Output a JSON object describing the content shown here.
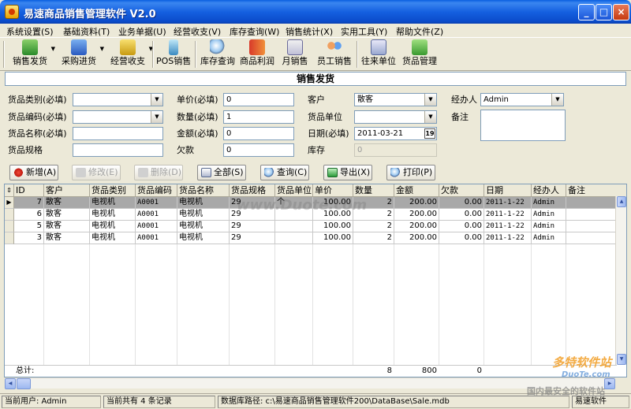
{
  "window": {
    "title": "易速商品销售管理软件 V2.0",
    "min_label": "_",
    "max_label": "□",
    "close_label": "×"
  },
  "menu": [
    "系统设置(S)",
    "基础资料(T)",
    "业务单据(U)",
    "经营收支(V)",
    "库存查询(W)",
    "销售统计(X)",
    "实用工具(Y)",
    "帮助文件(Z)"
  ],
  "toolbar": [
    {
      "label": "销售发货",
      "icon": "truck-icon",
      "dropdown": true
    },
    {
      "label": "采购进货",
      "icon": "cart-icon",
      "dropdown": true
    },
    {
      "label": "经营收支",
      "icon": "coins-icon",
      "dropdown": true
    },
    {
      "label": "POS销售",
      "icon": "scanner-icon",
      "dropdown": false
    },
    {
      "label": "库存查询",
      "icon": "magnifier-icon",
      "dropdown": false
    },
    {
      "label": "商品利润",
      "icon": "book-icon",
      "dropdown": false
    },
    {
      "label": "月销售",
      "icon": "calendar-icon",
      "dropdown": false
    },
    {
      "label": "员工销售",
      "icon": "people-icon",
      "dropdown": false
    },
    {
      "label": "往来单位",
      "icon": "contacts-icon",
      "dropdown": false
    },
    {
      "label": "货品管理",
      "icon": "gear-box-icon",
      "dropdown": false
    }
  ],
  "form": {
    "header": "销售发货",
    "labels": {
      "category": "货品类别(必填)",
      "code": "货品编码(必填)",
      "name": "货品名称(必填)",
      "spec": "货品规格",
      "price": "单价(必填)",
      "qty": "数量(必填)",
      "amount": "金额(必填)",
      "debt": "欠款",
      "customer": "客户",
      "unit": "货品单位",
      "date": "日期(必填)",
      "stock": "库存",
      "handler": "经办人",
      "memo": "备注"
    },
    "values": {
      "category": "",
      "code": "",
      "name": "",
      "spec": "",
      "price": "0",
      "qty": "1",
      "amount": "0",
      "debt": "0",
      "customer": "散客",
      "unit": "",
      "date": "2011-03-21",
      "date_btn": "19",
      "stock": "0",
      "handler": "Admin",
      "memo": ""
    }
  },
  "actions": [
    {
      "label": "新增(A)",
      "enabled": true,
      "icon": "plus-icon"
    },
    {
      "label": "修改(E)",
      "enabled": false,
      "icon": "edit-icon"
    },
    {
      "label": "删除(D)",
      "enabled": false,
      "icon": "delete-icon"
    },
    {
      "label": "全部(S)",
      "enabled": true,
      "icon": "list-icon"
    },
    {
      "label": "查询(C)",
      "enabled": true,
      "icon": "search-icon"
    },
    {
      "label": "导出(X)",
      "enabled": true,
      "icon": "export-icon"
    },
    {
      "label": "打印(P)",
      "enabled": true,
      "icon": "print-icon"
    }
  ],
  "table": {
    "columns": [
      "ID",
      "客户",
      "货品类别",
      "货品编码",
      "货品名称",
      "货品规格",
      "货品单位",
      "单价",
      "数量",
      "金额",
      "欠款",
      "日期",
      "经办人",
      "备注"
    ],
    "rows": [
      [
        "7",
        "散客",
        "电视机",
        "A0001",
        "电视机",
        "29",
        "个",
        "100.00",
        "2",
        "200.00",
        "0.00",
        "2011-1-22",
        "Admin",
        ""
      ],
      [
        "6",
        "散客",
        "电视机",
        "A0001",
        "电视机",
        "29",
        "",
        "100.00",
        "2",
        "200.00",
        "0.00",
        "2011-1-22",
        "Admin",
        ""
      ],
      [
        "5",
        "散客",
        "电视机",
        "A0001",
        "电视机",
        "29",
        "",
        "100.00",
        "2",
        "200.00",
        "0.00",
        "2011-1-22",
        "Admin",
        ""
      ],
      [
        "3",
        "散客",
        "电视机",
        "A0001",
        "电视机",
        "29",
        "",
        "100.00",
        "2",
        "200.00",
        "0.00",
        "2011-1-22",
        "Admin",
        ""
      ]
    ],
    "selected_index": 0,
    "total_label": "总计:",
    "total_qty": "8",
    "total_amount": "800",
    "total_debt": "0"
  },
  "status": {
    "user": "当前用户: Admin",
    "records": "当前共有 4 条记录",
    "db_path": "数据库路径: c:\\易速商品销售管理软件200\\DataBase\\Sale.mdb",
    "brand": "易速软件"
  },
  "watermarks": {
    "center": "www.Duote.com",
    "brand_cn": "多特软件站",
    "brand_en": "DuoTe.com",
    "slogan": "国内最安全的软件站"
  },
  "colors": {
    "titlebar": "#0B4CCB",
    "selected_row": "#A8A8A8",
    "window_bg": "#ECE9D8"
  }
}
